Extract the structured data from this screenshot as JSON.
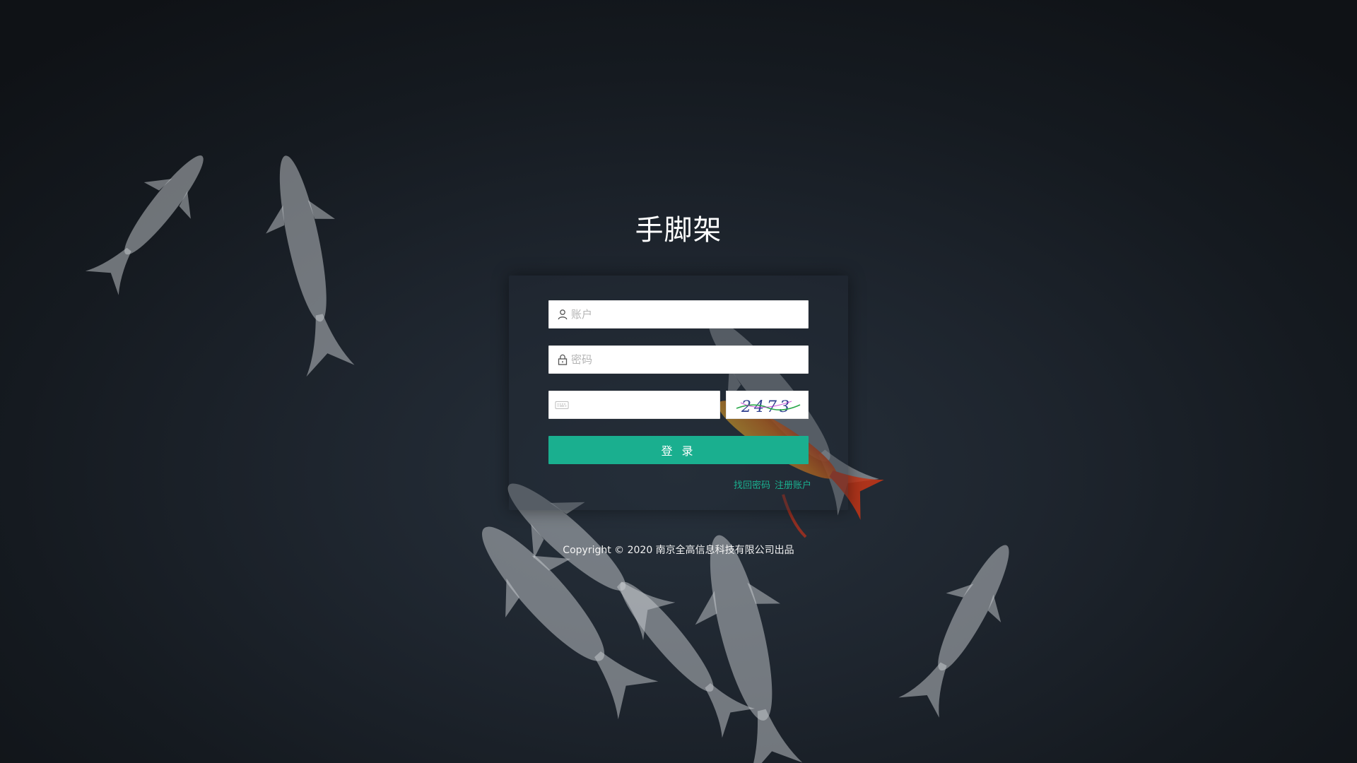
{
  "app": {
    "title": "手脚架"
  },
  "login_form": {
    "username_placeholder": "账户",
    "username_value": "",
    "password_placeholder": "密码",
    "password_value": "",
    "captcha_placeholder": "",
    "captcha_value": "",
    "captcha_code": "2473",
    "submit_label": "登 录",
    "forgot_password_label": "找回密码",
    "register_label": "注册账户"
  },
  "footer": {
    "copyright": "Copyright © 2020 南京全高信息科技有限公司出品"
  },
  "icons": {
    "username": "user-icon",
    "password": "lock-icon",
    "captcha": "keyboard-icon"
  },
  "colors": {
    "accent": "#1aaf8f",
    "background": "#1e252e",
    "title_text": "#ffffff"
  }
}
